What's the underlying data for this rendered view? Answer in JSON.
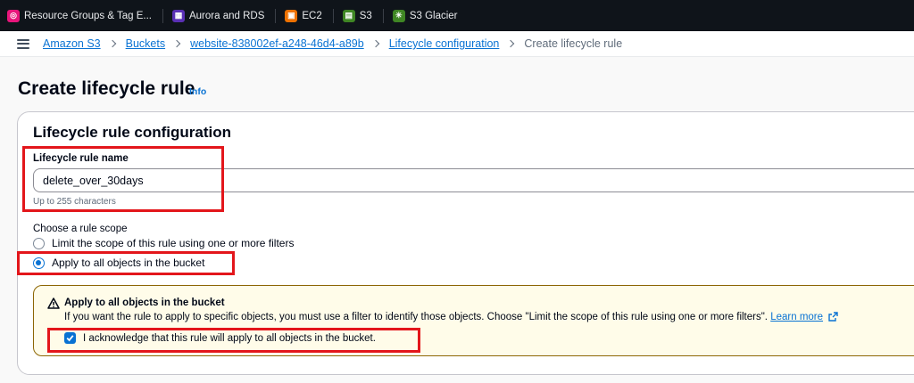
{
  "favorites": [
    {
      "label": "Resource Groups & Tag E...",
      "icon": "resource-groups-icon",
      "color": "#e7157b"
    },
    {
      "label": "Aurora and RDS",
      "icon": "rds-icon",
      "color": "#5a30b5"
    },
    {
      "label": "EC2",
      "icon": "ec2-icon",
      "color": "#ed7100"
    },
    {
      "label": "S3",
      "icon": "s3-icon",
      "color": "#3f8624"
    },
    {
      "label": "S3 Glacier",
      "icon": "s3-glacier-icon",
      "color": "#3f8624"
    }
  ],
  "breadcrumbs": [
    {
      "label": "Amazon S3"
    },
    {
      "label": "Buckets"
    },
    {
      "label": "website-838002ef-a248-46d4-a89b"
    },
    {
      "label": "Lifecycle configuration"
    },
    {
      "label": "Create lifecycle rule"
    }
  ],
  "page": {
    "title": "Create lifecycle rule",
    "info": "Info"
  },
  "config": {
    "title": "Lifecycle rule configuration",
    "name_label": "Lifecycle rule name",
    "name_value": "delete_over_30days",
    "name_constraint": "Up to 255 characters",
    "scope_label": "Choose a rule scope",
    "scope_options": [
      {
        "label": "Limit the scope of this rule using one or more filters",
        "selected": false
      },
      {
        "label": "Apply to all objects in the bucket",
        "selected": true
      }
    ]
  },
  "alert": {
    "title": "Apply to all objects in the bucket",
    "body": "If you want the rule to apply to specific objects, you must use a filter to identify those objects. Choose \"Limit the scope of this rule using one or more filters\".",
    "learn_more": "Learn more",
    "ack_label": "I acknowledge that this rule will apply to all objects in the bucket.",
    "ack_checked": true
  },
  "colors": {
    "accent": "#0972d3",
    "warning_border": "#8d6605",
    "highlight": "#e3161b"
  }
}
